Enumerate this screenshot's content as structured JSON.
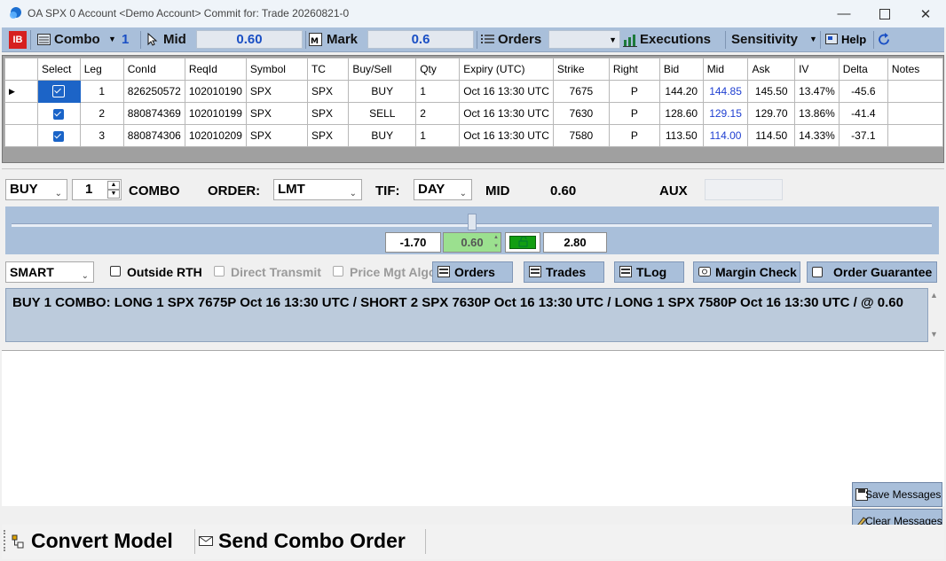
{
  "window": {
    "title": "OA SPX 0 Account <Demo Account> Commit for: Trade 20260821-0"
  },
  "toolbar": {
    "logo": "IB",
    "combo_label": "Combo",
    "combo_count": "1",
    "mid_label": "Mid",
    "mid_value": "0.60",
    "mark_label": "Mark",
    "mark_value": "0.6",
    "orders_label": "Orders",
    "executions_label": "Executions",
    "sensitivity_label": "Sensitivity",
    "help_label": "Help"
  },
  "grid": {
    "columns": [
      "Select",
      "Leg",
      "ConId",
      "ReqId",
      "Symbol",
      "TC",
      "Buy/Sell",
      "Qty",
      "Expiry (UTC)",
      "Strike",
      "Right",
      "Bid",
      "Mid",
      "Ask",
      "IV",
      "Delta",
      "Notes"
    ],
    "rows": [
      {
        "leg": "1",
        "conid": "826250572",
        "reqid": "102010190",
        "symbol": "SPX",
        "tc": "SPX",
        "side": "BUY",
        "qty": "1",
        "expiry": "Oct 16 13:30 UTC",
        "strike": "7675",
        "right": "P",
        "bid": "144.20",
        "mid": "144.85",
        "ask": "145.50",
        "iv": "13.47%",
        "delta": "-45.6",
        "notes": ""
      },
      {
        "leg": "2",
        "conid": "880874369",
        "reqid": "102010199",
        "symbol": "SPX",
        "tc": "SPX",
        "side": "SELL",
        "qty": "2",
        "expiry": "Oct 16 13:30 UTC",
        "strike": "7630",
        "right": "P",
        "bid": "128.60",
        "mid": "129.15",
        "ask": "129.70",
        "iv": "13.86%",
        "delta": "-41.4",
        "notes": ""
      },
      {
        "leg": "3",
        "conid": "880874306",
        "reqid": "102010209",
        "symbol": "SPX",
        "tc": "SPX",
        "side": "BUY",
        "qty": "1",
        "expiry": "Oct 16 13:30 UTC",
        "strike": "7580",
        "right": "P",
        "bid": "113.50",
        "mid": "114.00",
        "ask": "114.50",
        "iv": "14.33%",
        "delta": "-37.1",
        "notes": ""
      }
    ]
  },
  "order": {
    "side": "BUY",
    "quantity": "1",
    "combo_label": "COMBO",
    "order_label": "ORDER:",
    "order_type": "LMT",
    "tif_label": "TIF:",
    "tif": "DAY",
    "mid_label": "MID",
    "mid_value": "0.60",
    "aux_label": "AUX",
    "aux_value": ""
  },
  "slider": {
    "min": "-1.70",
    "value": "0.60",
    "max": "2.80",
    "position": 0.5
  },
  "routing": {
    "destination": "SMART",
    "outside_rth": "Outside RTH",
    "direct_transmit": "Direct Transmit",
    "price_mgt_algo": "Price Mgt Algo",
    "orders_button": "Orders",
    "trades_button": "Trades",
    "tlog_button": "TLog",
    "margin_check_button": "Margin Check",
    "order_guarantee": "Order Guarantee"
  },
  "description": "BUY 1 COMBO: LONG 1 SPX 7675P Oct 16 13:30 UTC / SHORT 2 SPX 7630P Oct 16 13:30 UTC / LONG 1 SPX 7580P Oct 16 13:30 UTC /  @ 0.60",
  "messages": {
    "save_label": "Save Messages",
    "clear_label": "Clear Messages"
  },
  "bottom": {
    "convert_label": "Convert Model",
    "send_label": "Send Combo Order"
  },
  "colors": {
    "toolbar": "#a9bfda",
    "mid_blue": "#1f3fd1",
    "logo_red": "#d6201f",
    "checkbox_blue": "#1a64c8",
    "lock_green": "#129e12"
  },
  "icons": [
    "app-icon",
    "ib-logo",
    "combo-icon",
    "cursor-icon",
    "mark-icon",
    "orders-list-icon",
    "executions-icon",
    "help-icon",
    "refresh-icon",
    "lock-icon",
    "save-icon",
    "clear-icon",
    "convert-icon",
    "send-icon"
  ]
}
